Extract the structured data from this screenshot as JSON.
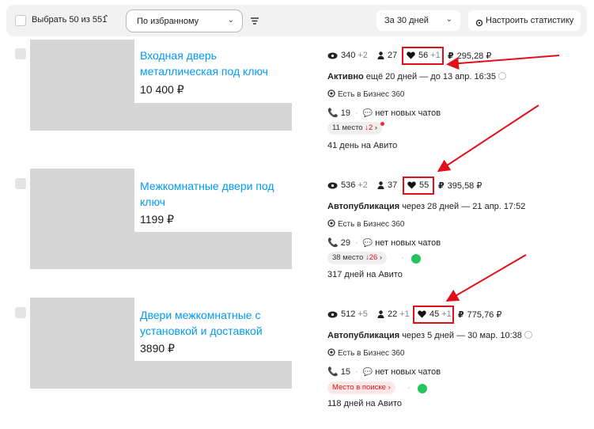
{
  "toolbar": {
    "select_label": "Выбрать 50 из 551",
    "filter_label": "По избранному",
    "period_label": "За 30 дней",
    "stats_button_label": "Настроить статистику"
  },
  "items": [
    {
      "title": "Входная дверь металлическая под ключ",
      "price": "10 400 ₽",
      "views": "340",
      "views_delta": "+2",
      "contacts": "27",
      "favorites": "56",
      "favorites_delta": "+1",
      "spend": "295,28 ₽",
      "status_bold": "Активно",
      "status_rest": "ещё 20 дней — до 13 апр. 16:35",
      "business": "Есть в Бизнес 360",
      "calls": "19",
      "chats": "нет новых чатов",
      "rank_label": "11 место",
      "rank_delta": "↓2",
      "days_on_avito": "41 день на Авито"
    },
    {
      "title": "Межкомнатные двери под ключ",
      "price": "1199 ₽",
      "views": "536",
      "views_delta": "+2",
      "contacts": "37",
      "favorites": "55",
      "favorites_delta": "",
      "spend": "395,58 ₽",
      "status_bold": "Автопубликация",
      "status_rest": "через 28 дней — 21 апр. 17:52",
      "business": "Есть в Бизнес 360",
      "calls": "29",
      "chats": "нет новых чатов",
      "rank_label": "38 место",
      "rank_delta": "↓26",
      "days_on_avito": "317 дней на Авито"
    },
    {
      "title": "Двери межкомнатные с установкой и доставкой",
      "price": "3890 ₽",
      "views": "512",
      "views_delta": "+5",
      "contacts": "22",
      "contacts_delta": "+1",
      "favorites": "45",
      "favorites_delta": "+1",
      "spend": "775,76 ₽",
      "status_bold": "Автопубликация",
      "status_rest": "через 5 дней — 30 мар. 10:38",
      "business": "Есть в Бизнес 360",
      "calls": "15",
      "chats": "нет новых чатов",
      "rank_label": "Место в поиске ›",
      "days_on_avito": "118 дней на Авито"
    }
  ],
  "colors": {
    "accent": "#0099f7",
    "highlight": "#e0101a",
    "promo": "#22c55e"
  }
}
